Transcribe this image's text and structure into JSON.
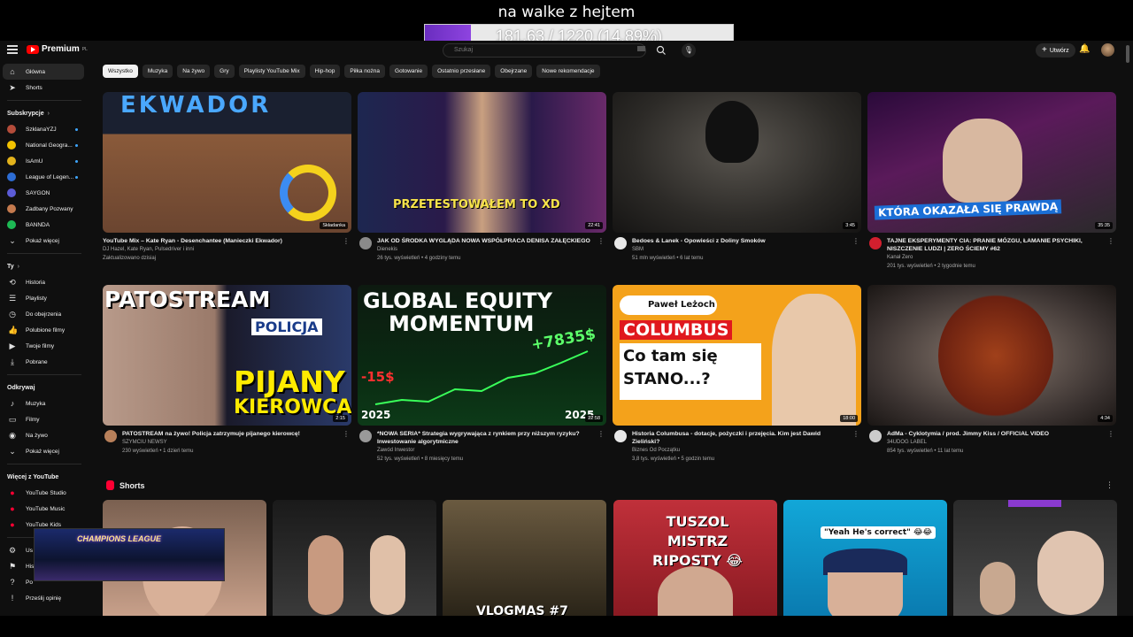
{
  "overlay": {
    "title": "na walke z hejtem",
    "progress_text": "181.63 / 1220 (14.89%)",
    "progress_fraction": 0.1489
  },
  "topbar": {
    "logo": "Premium",
    "logo_sup": "PL",
    "search_placeholder": "Szukaj",
    "create_label": "Utwórz"
  },
  "sidebar": {
    "main": [
      {
        "label": "Główna",
        "icon": "home-icon"
      },
      {
        "label": "Shorts",
        "icon": "shorts-icon"
      }
    ],
    "subscriptions_header": "Subskrypcje",
    "subscriptions": [
      {
        "label": "SzklanaYZJ",
        "color": "#b44c3a"
      },
      {
        "label": "National Geogra...",
        "color": "#f2c200"
      },
      {
        "label": "IsAmU",
        "color": "#e3b31c"
      },
      {
        "label": "League of Legen...",
        "color": "#2d6dd4"
      },
      {
        "label": "SAYGON",
        "color": "#5b5bd6"
      },
      {
        "label": "Zadbany Pozwany",
        "color": "#c47a4e"
      },
      {
        "label": "BANNDA",
        "color": "#1db954"
      },
      {
        "label": "Pokaż więcej",
        "color": ""
      }
    ],
    "you_header": "Ty",
    "you": [
      {
        "label": "Historia",
        "icon": "history-icon"
      },
      {
        "label": "Playlisty",
        "icon": "playlist-icon"
      },
      {
        "label": "Do obejrzenia",
        "icon": "watch-later-icon"
      },
      {
        "label": "Polubione filmy",
        "icon": "like-icon"
      },
      {
        "label": "Twoje filmy",
        "icon": "your-videos-icon"
      },
      {
        "label": "Pobrane",
        "icon": "download-icon"
      }
    ],
    "explore_header": "Odkrywaj",
    "explore": [
      {
        "label": "Muzyka",
        "icon": "music-icon"
      },
      {
        "label": "Filmy",
        "icon": "movies-icon"
      },
      {
        "label": "Na żywo",
        "icon": "live-icon"
      },
      {
        "label": "Pokaż więcej",
        "icon": "chevron-down-icon"
      }
    ],
    "more_header": "Więcej z YouTube",
    "more": [
      {
        "label": "YouTube Studio"
      },
      {
        "label": "YouTube Music"
      },
      {
        "label": "YouTube Kids"
      }
    ],
    "bottom": [
      {
        "label": "Us",
        "icon": "gear-icon"
      },
      {
        "label": "His",
        "icon": "flag-icon"
      },
      {
        "label": "Po",
        "icon": "help-icon"
      },
      {
        "label": "Prześlij opinię",
        "icon": "feedback-icon"
      }
    ]
  },
  "chips": [
    "Wszystko",
    "Muzyka",
    "Na żywo",
    "Gry",
    "Playlisty YouTube Mix",
    "Hip-hop",
    "Piłka nożna",
    "Gotowanie",
    "Ostatnio przesłane",
    "Obejrzane",
    "Nowe rekomendacje"
  ],
  "videos": [
    {
      "title": "YouTube Mix – Kate Ryan - Desenchantee (Manieczki Ekwador)",
      "line1": "DJ Hazel, Kate Ryan, Pulsedriver i inni",
      "line2": "Zaktualizowano dzisiaj",
      "duration": "Składanka",
      "thumb_text": "EKWADOR"
    },
    {
      "title": "JAK OD ŚRODKA WYGLĄDA NOWA WSPÓŁPRACA DENISA ZAŁĘCKIEGO",
      "line1": "Dienekis",
      "line2": "26 tys. wyświetleń • 4 godziny temu",
      "duration": "22:41",
      "thumb_text": "PRZETESTOWAŁEM TO XD"
    },
    {
      "title": "Bedoes & Lanek - Opowieści z Doliny Smoków",
      "line1": "SBM",
      "line2": "51 mln wyświetleń • 6 lat temu",
      "duration": "3:45",
      "thumb_text": ""
    },
    {
      "title": "TAJNE EKSPERYMENTY CIA: PRANIE MÓZGU, ŁAMANIE PSYCHIKI, NISZCZENIE LUDZI | ZERO ŚCIEMY #62",
      "line1": "Kanał Zero",
      "line2": "201 tys. wyświetleń • 2 tygodnie temu",
      "duration": "35:35",
      "thumb_text": "KTÓRA OKAZAŁA SIĘ PRAWDĄ"
    },
    {
      "title": "PATOSTREAM na żywo! Policja zatrzymuje pijanego kierowcę!",
      "line1": "SZYMCIU NEWSY",
      "line2": "230 wyświetleń • 1 dzień temu",
      "duration": "2:15",
      "thumb_text": "PATOSTREAM",
      "thumb_text2": "POLICJA",
      "thumb_text3": "PIJANY",
      "thumb_text4": "KIEROWCA"
    },
    {
      "title": "*NOWA SERIA* Strategia wygrywająca z rynkiem przy niższym ryzyku? Inwestowanie algorytmiczne",
      "line1": "Zawód Inwestor",
      "line2": "52 tys. wyświetleń • 8 miesięcy temu",
      "duration": "22:58",
      "thumb_text": "GLOBAL EQUITY",
      "thumb_text2": "MOMENTUM",
      "thumb_text3": "+7835$",
      "thumb_text4": "-15$",
      "thumb_text5": "2025",
      "thumb_text6": "2025"
    },
    {
      "title": "Historia Columbusa - dotacje, pożyczki i przejęcia. Kim jest Dawid Zieliński?",
      "line1": "Biznes Od Początku",
      "line2": "3,8 tys. wyświetleń • 5 godzin temu",
      "duration": "18:00",
      "thumb_text": "Paweł Leżoch",
      "thumb_text2": "COLUMBUS",
      "thumb_text3": "Co tam się",
      "thumb_text4": "STANO...?"
    },
    {
      "title": "AdMa - Cyklotymia / prod. Jimmy Kiss / OFFICIAL VIDEO",
      "line1": "34UDOG LABEL",
      "line2": "854 tys. wyświetleń • 11 lat temu",
      "duration": "4:34",
      "thumb_text": ""
    }
  ],
  "shorts": {
    "header": "Shorts",
    "items": [
      {
        "text": ""
      },
      {
        "text": ""
      },
      {
        "text": "VLOGMAS #7"
      },
      {
        "text": "TUSZOL MISTRZ RIPOSTY 😂"
      },
      {
        "text": "\"Yeah He's correct\" 😂😂"
      },
      {
        "text": ""
      }
    ]
  },
  "pip": {
    "text": "CHAMPIONS LEAGUE"
  }
}
